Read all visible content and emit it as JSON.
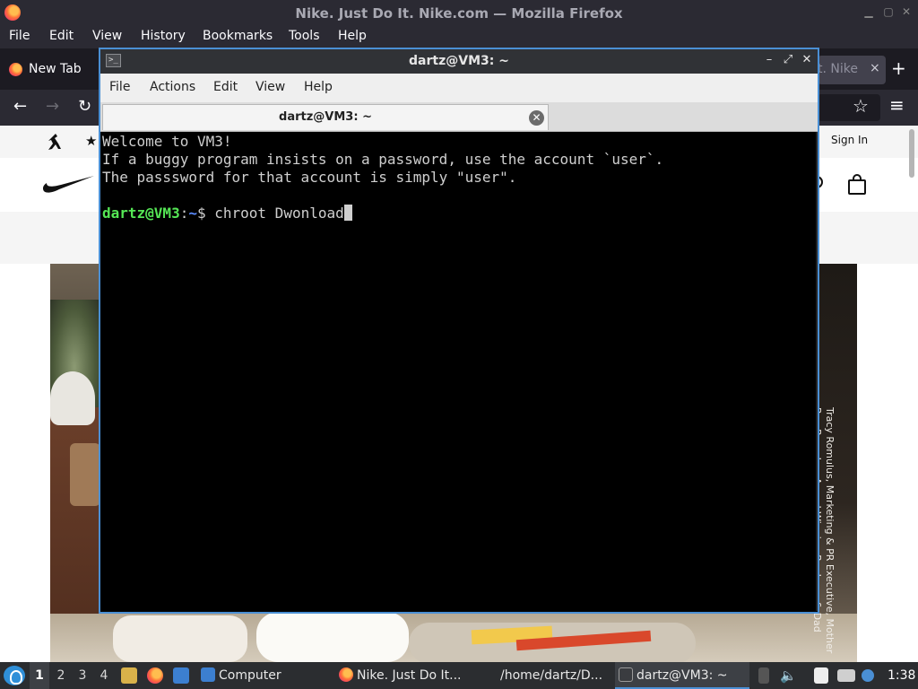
{
  "firefox": {
    "title": "Nike. Just Do It. Nike.com — Mozilla Firefox",
    "menu": [
      "File",
      "Edit",
      "View",
      "History",
      "Bookmarks",
      "Tools",
      "Help"
    ],
    "tabs": {
      "new_tab": "New Tab",
      "nike_fragment": "t. Nike",
      "close": "×",
      "add": "+"
    },
    "nav": {
      "back": "←",
      "forward": "→",
      "reload": "↻",
      "bookmark": "☆",
      "menu": "≡"
    }
  },
  "nike": {
    "sign_in": "Sign In",
    "hero_caption": "Tracy Romulus, Marketing & PR Executive, Mother\nRay Romulus, Award-Winning Producer & Dad"
  },
  "terminal": {
    "title": "dartz@VM3: ~",
    "menu": [
      "File",
      "Actions",
      "Edit",
      "View",
      "Help"
    ],
    "tab_label": "dartz@VM3: ~",
    "lines": [
      "Welcome to VM3!",
      "If a buggy program insists on a password, use the account `user`.",
      "The passsword for that account is simply \"user\"."
    ],
    "prompt": {
      "user_host": "dartz@VM3",
      "sep": ":",
      "path": "~",
      "symbol": "$ ",
      "command": "chroot Dwonload"
    }
  },
  "taskbar": {
    "workspaces": [
      "1",
      "2",
      "3",
      "4"
    ],
    "tasks": [
      {
        "label": "Computer"
      },
      {
        "label": "Nike. Just Do It..."
      },
      {
        "label": "/home/dartz/D..."
      },
      {
        "label": "dartz@VM3: ~"
      }
    ],
    "clock": "1:38"
  },
  "colors": {
    "accent": "#4a8fd4",
    "prompt_user": "#55e655",
    "prompt_path": "#5b8cff"
  }
}
